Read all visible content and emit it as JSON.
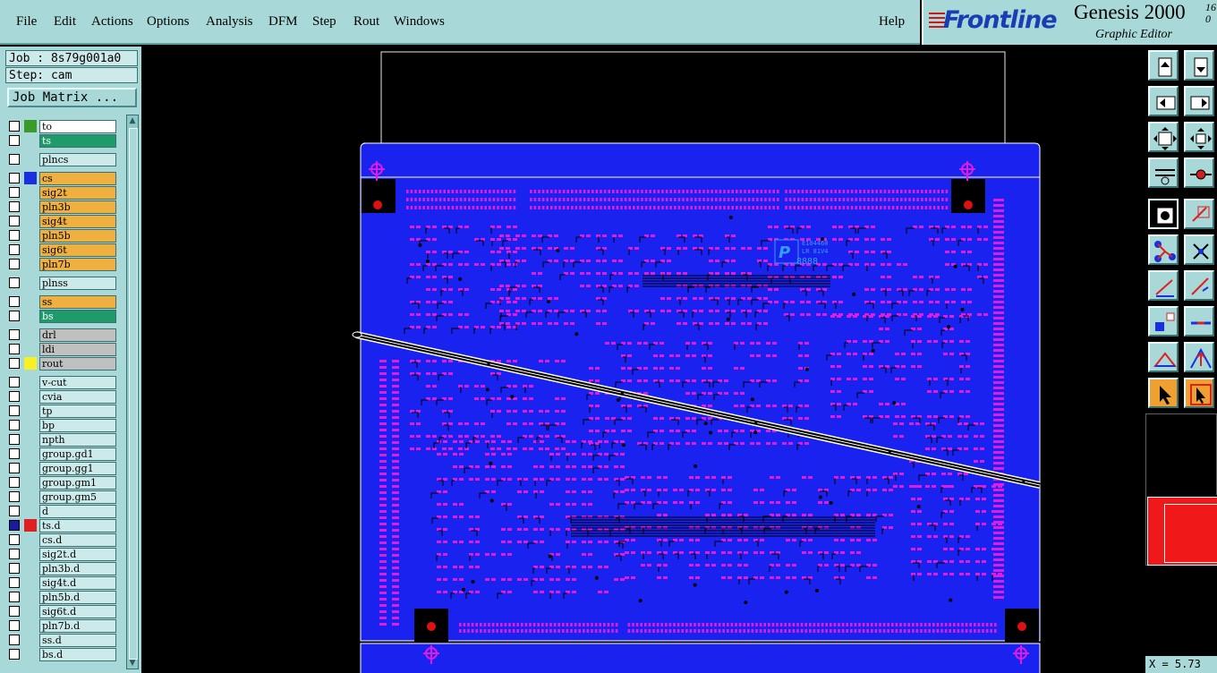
{
  "menu": {
    "file": "File",
    "edit": "Edit",
    "actions": "Actions",
    "options": "Options",
    "analysis": "Analysis",
    "dfm": "DFM",
    "step": "Step",
    "rout": "Rout",
    "windows": "Windows",
    "help": "Help"
  },
  "brand": {
    "logo": "Frontline",
    "app": "Genesis 2000",
    "version_top": "16",
    "version_bottom": "0",
    "subtitle": "Graphic Editor"
  },
  "job": {
    "job_label": "Job : 8s79g001a0",
    "step_label": "Step: cam",
    "matrix_button": "Job Matrix ..."
  },
  "layers": [
    {
      "name": "to",
      "fill": "#ffffff",
      "swatch": "#3a9a2a",
      "mark": ""
    },
    {
      "name": "ts",
      "fill": "#1f9a6a",
      "swatch": "",
      "mark": ""
    },
    {
      "name": "plncs",
      "fill": "#cdeaea",
      "swatch": "",
      "mark": ""
    },
    {
      "name": "cs",
      "fill": "#f0b040",
      "swatch": "#1a30e0",
      "mark": "✎"
    },
    {
      "name": "sig2t",
      "fill": "#f0b040",
      "swatch": "",
      "mark": "✎"
    },
    {
      "name": "pln3b",
      "fill": "#f0b040",
      "swatch": "",
      "mark": ""
    },
    {
      "name": "sig4t",
      "fill": "#f0b040",
      "swatch": "",
      "mark": "✎"
    },
    {
      "name": "pln5b",
      "fill": "#f0b040",
      "swatch": "",
      "mark": ""
    },
    {
      "name": "sig6t",
      "fill": "#f0b040",
      "swatch": "",
      "mark": "✎"
    },
    {
      "name": "pln7b",
      "fill": "#f0b040",
      "swatch": "",
      "mark": ""
    },
    {
      "name": "plnss",
      "fill": "#cdeaea",
      "swatch": "",
      "mark": ""
    },
    {
      "name": "ss",
      "fill": "#f0b040",
      "swatch": "",
      "mark": "✎"
    },
    {
      "name": "bs",
      "fill": "#1f9a6a",
      "swatch": "",
      "mark": ""
    },
    {
      "name": "drl",
      "fill": "#c0c0c0",
      "swatch": "",
      "mark": ""
    },
    {
      "name": "ldi",
      "fill": "#c0c0c0",
      "swatch": "",
      "mark": ""
    },
    {
      "name": "rout",
      "fill": "#c0c0c0",
      "swatch": "#f8f020",
      "mark": ""
    },
    {
      "name": "v-cut",
      "fill": "#cdeaea",
      "swatch": "",
      "mark": ""
    },
    {
      "name": "cvia",
      "fill": "#cdeaea",
      "swatch": "",
      "mark": ""
    },
    {
      "name": "tp",
      "fill": "#cdeaea",
      "swatch": "",
      "mark": ""
    },
    {
      "name": "bp",
      "fill": "#cdeaea",
      "swatch": "",
      "mark": ""
    },
    {
      "name": "npth",
      "fill": "#cdeaea",
      "swatch": "",
      "mark": ""
    },
    {
      "name": "group.gd1",
      "fill": "#cdeaea",
      "swatch": "",
      "mark": "✎"
    },
    {
      "name": "group.gg1",
      "fill": "#cdeaea",
      "swatch": "",
      "mark": ""
    },
    {
      "name": "group.gm1",
      "fill": "#cdeaea",
      "swatch": "",
      "mark": ""
    },
    {
      "name": "group.gm5",
      "fill": "#cdeaea",
      "swatch": "",
      "mark": ""
    },
    {
      "name": "d",
      "fill": "#cdeaea",
      "swatch": "",
      "mark": ""
    },
    {
      "name": "ts.d",
      "fill": "#cdeaea",
      "swatch": "#e02020",
      "mark": "▫",
      "active": true
    },
    {
      "name": "cs.d",
      "fill": "#cdeaea",
      "swatch": "",
      "mark": "✎"
    },
    {
      "name": "sig2t.d",
      "fill": "#cdeaea",
      "swatch": "",
      "mark": "✎"
    },
    {
      "name": "pln3b.d",
      "fill": "#cdeaea",
      "swatch": "",
      "mark": ""
    },
    {
      "name": "sig4t.d",
      "fill": "#cdeaea",
      "swatch": "",
      "mark": "✎"
    },
    {
      "name": "pln5b.d",
      "fill": "#cdeaea",
      "swatch": "",
      "mark": ""
    },
    {
      "name": "sig6t.d",
      "fill": "#cdeaea",
      "swatch": "",
      "mark": "✎"
    },
    {
      "name": "pln7b.d",
      "fill": "#cdeaea",
      "swatch": "",
      "mark": ""
    },
    {
      "name": "ss.d",
      "fill": "#cdeaea",
      "swatch": "",
      "mark": "✎"
    },
    {
      "name": "bs.d",
      "fill": "#cdeaea",
      "swatch": "",
      "mark": ""
    }
  ],
  "colors": {
    "board": "#1a22f0",
    "pad": "#e01ce0",
    "trace": "#000000",
    "panel": "#a8d8d8",
    "fiducial": "#e01010"
  },
  "board_text": {
    "chip_line1": "E104460",
    "chip_line2": "LR 81V4",
    "chip_line3": "8888"
  },
  "toolbar": [
    "clip-area-icon",
    "clip-area-down-icon",
    "zoom-left-icon",
    "zoom-right-icon",
    "fit-screen-icon",
    "zoom-center-icon",
    "snap-settings-icon",
    "measure-icon",
    "feature-select-icon",
    "reshape-icon",
    "net-connect-icon",
    "cross-icon",
    "line-add-icon",
    "line-edit-icon",
    "pad-add-icon",
    "minus-line-icon",
    "triangle-icon",
    "arrow-up-triangle-icon",
    "pointer-icon",
    "select-box-icon"
  ],
  "coord": "X = 5.73"
}
